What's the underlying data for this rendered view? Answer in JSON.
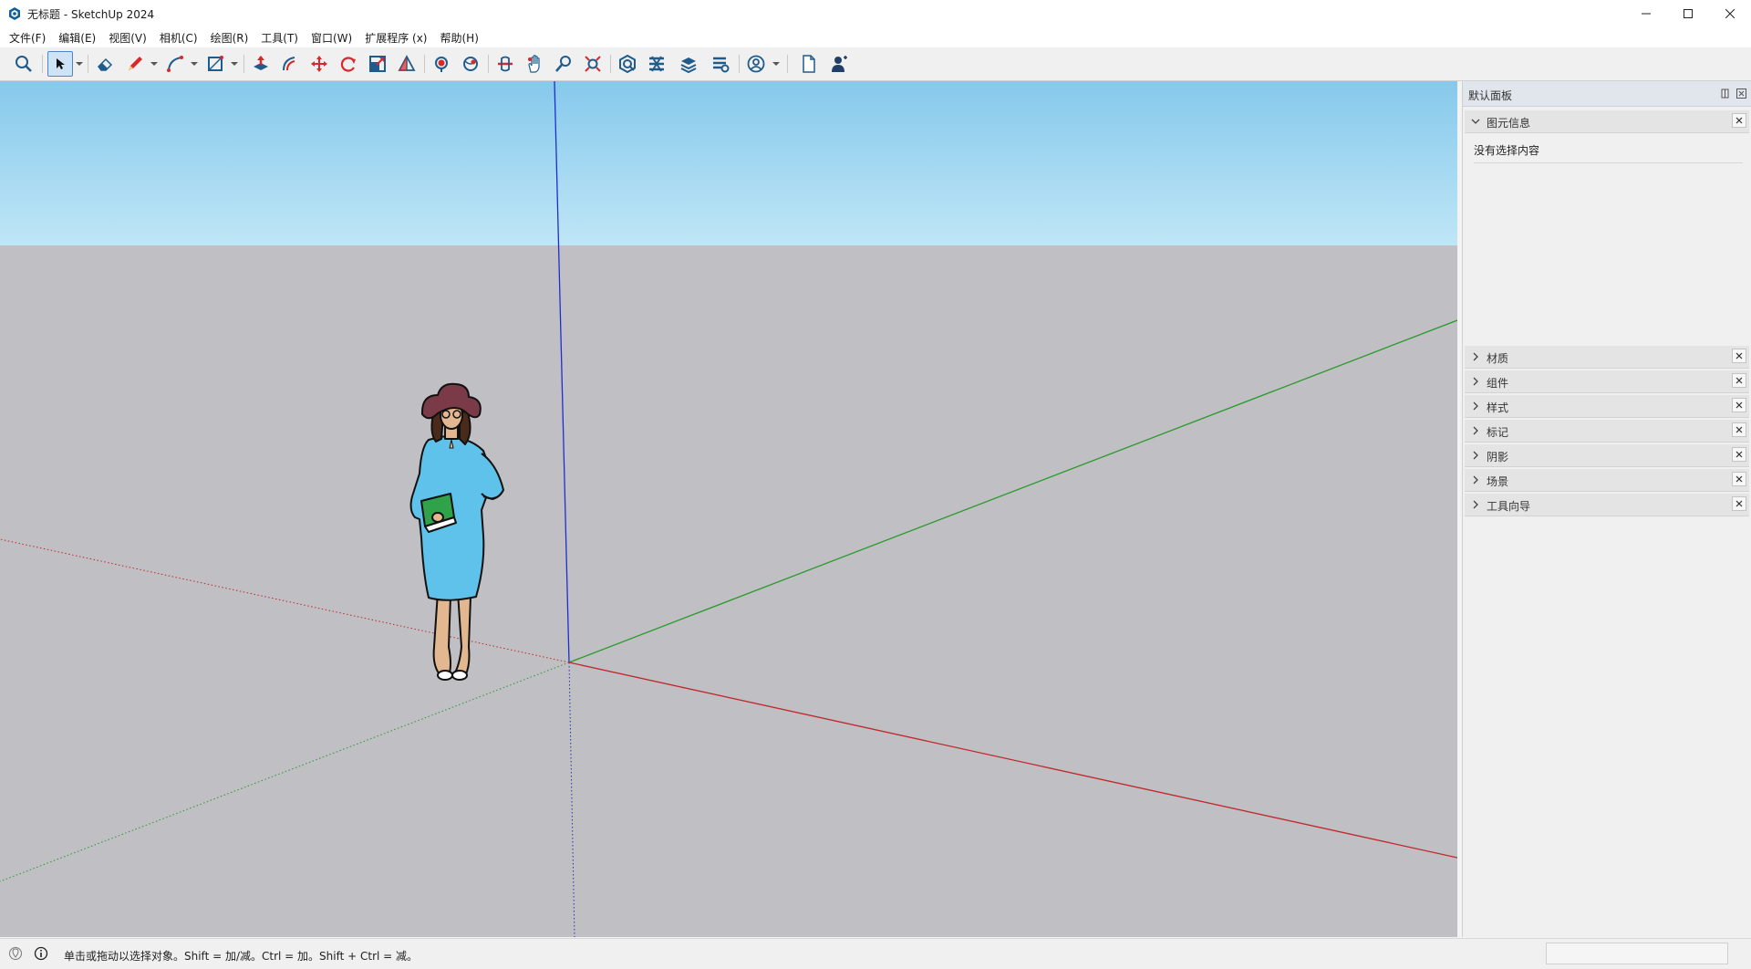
{
  "window": {
    "title": "无标题 - SketchUp 2024"
  },
  "menu": [
    {
      "label": "文件(F)"
    },
    {
      "label": "编辑(E)"
    },
    {
      "label": "视图(V)"
    },
    {
      "label": "相机(C)"
    },
    {
      "label": "绘图(R)"
    },
    {
      "label": "工具(T)"
    },
    {
      "label": "窗口(W)"
    },
    {
      "label": "扩展程序 (x)"
    },
    {
      "label": "帮助(H)"
    }
  ],
  "toolbar": {
    "tools": [
      {
        "icon": "search-icon"
      },
      {
        "icon": "select-arrow-icon",
        "active": true
      },
      {
        "icon": "eraser-icon"
      },
      {
        "icon": "pencil-icon"
      },
      {
        "icon": "arc-icon"
      },
      {
        "icon": "rectangle-icon"
      },
      {
        "icon": "push-pull-icon"
      },
      {
        "icon": "offset-icon"
      },
      {
        "icon": "move-icon"
      },
      {
        "icon": "rotate-icon"
      },
      {
        "icon": "scale-icon"
      },
      {
        "icon": "tape-measure-icon"
      },
      {
        "icon": "paint-bucket-icon"
      },
      {
        "icon": "orbit-icon"
      },
      {
        "icon": "pan-icon"
      },
      {
        "icon": "zoom-icon"
      },
      {
        "icon": "zoom-extents-icon"
      },
      {
        "icon": "3d-warehouse-icon"
      },
      {
        "icon": "extension-warehouse-icon"
      },
      {
        "icon": "layout-icon"
      },
      {
        "icon": "extension-manager-icon"
      },
      {
        "icon": "account-icon"
      },
      {
        "icon": "new-document-icon"
      },
      {
        "icon": "user-profile-icon"
      }
    ]
  },
  "panel": {
    "title": "默认面板",
    "entity_info": {
      "label": "图元信息",
      "empty_text": "没有选择内容"
    },
    "sections": [
      {
        "label": "材质"
      },
      {
        "label": "组件"
      },
      {
        "label": "样式"
      },
      {
        "label": "标记"
      },
      {
        "label": "阴影"
      },
      {
        "label": "场景"
      },
      {
        "label": "工具向导"
      }
    ]
  },
  "status": {
    "text": "单击或拖动以选择对象。Shift = 加/减。Ctrl = 加。Shift + Ctrl = 减。"
  },
  "colors": {
    "sky_top": "#86c9ec",
    "sky_bottom": "#bfe6f6",
    "ground": "#bfbfc4",
    "axis_red": "#c0282a",
    "axis_green": "#2a9a2a",
    "axis_blue": "#1f2fcf",
    "accent": "#1f5c8c"
  }
}
